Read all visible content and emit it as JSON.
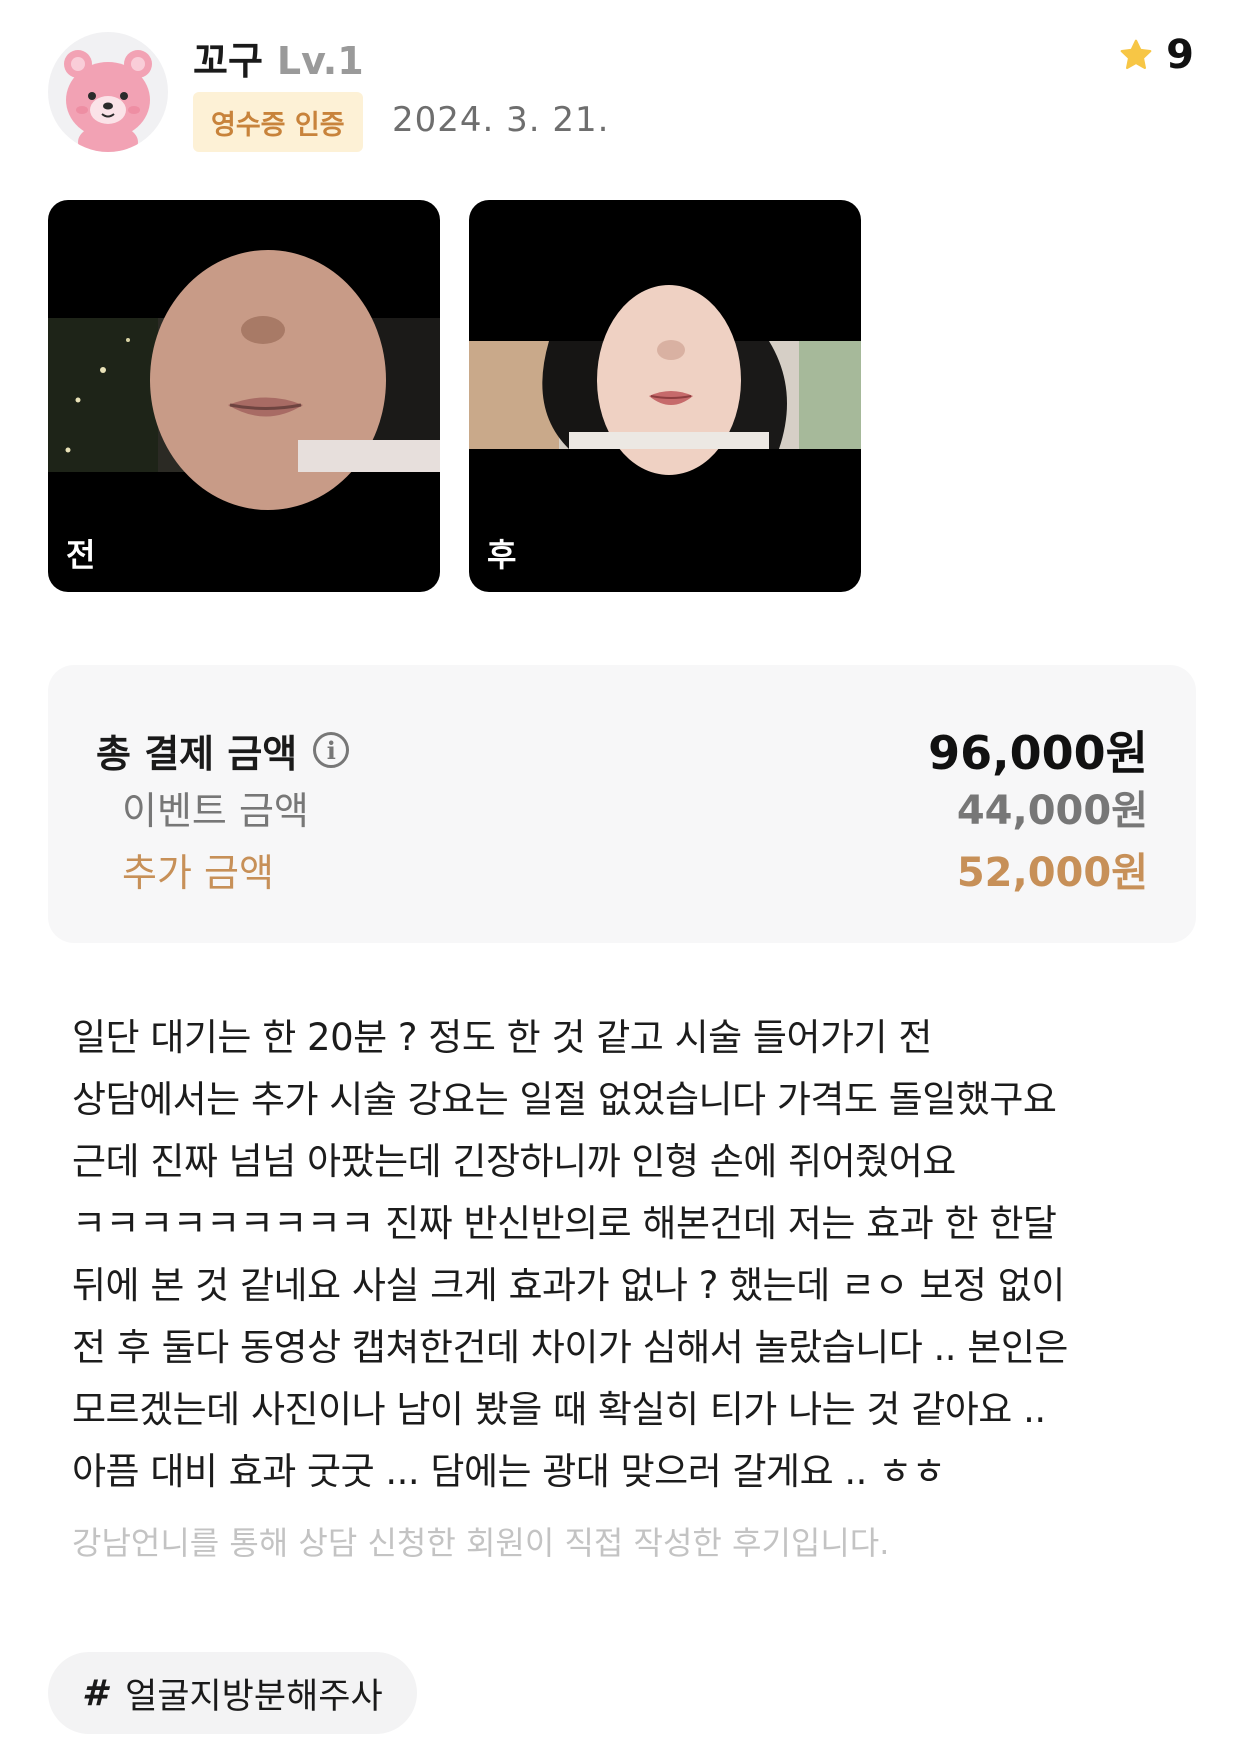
{
  "user": {
    "name": "꼬구",
    "level": "Lv.1",
    "badge": "영수증 인증",
    "date": "2024. 3. 21.",
    "rating": "9",
    "colors": {
      "badge_bg": "#fdf1d6",
      "badge_text": "#c8833b",
      "star": "#f7c645"
    }
  },
  "photos": {
    "before_label": "전",
    "after_label": "후"
  },
  "price": {
    "total_label": "총 결제 금액",
    "total_value": "96,000원",
    "event_label": "이벤트 금액",
    "event_value": "44,000원",
    "extra_label": "추가 금액",
    "extra_value": "52,000원",
    "accent": "#c79058"
  },
  "review": {
    "lines": [
      "일단 대기는 한 20분 ? 정도 한 것 같고 시술 들어가기 전",
      "상담에서는 추가 시술 강요는 일절 없었습니다 가격도 돌일했구요",
      "근데 진짜 넘넘 아팠는데 긴장하니까 인형 손에 쥐어줬어요",
      "ㅋㅋㅋㅋㅋㅋㅋㅋㅋ 진짜 반신반의로 해본건데 저는 효과 한 한달",
      "뒤에 본 것 같네요 사실 크게 효과가 없나 ? 했는데 ㄹㅇ 보정 없이",
      "전 후 둘다 동영상 캡쳐한건데 차이가 심해서 놀랐습니다 .. 본인은",
      "모르겠는데 사진이나 남이 봤을 때 확실히 티가 나는 것 같아요 ..",
      "아픔 대비 효과 굿굿 ... 담에는 광대 맞으러 갈게요 .. ㅎㅎ"
    ],
    "disclaimer": "강남언니를 통해 상담 신청한 회원이 직접 작성한 후기입니다."
  },
  "tag": {
    "symbol": "#",
    "label": "얼굴지방분해주사"
  }
}
